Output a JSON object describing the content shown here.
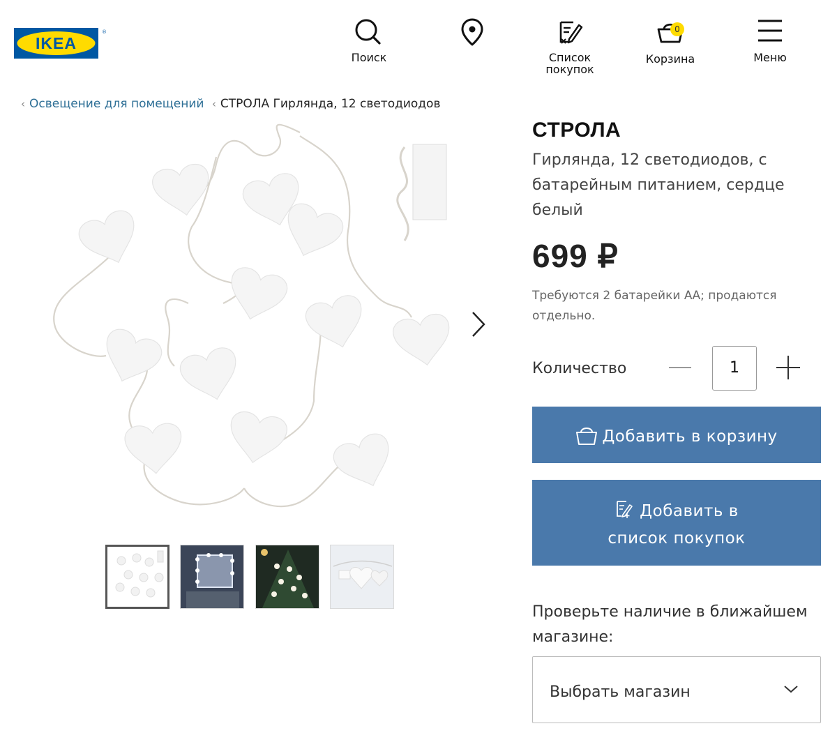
{
  "header": {
    "logo_text": "IKEA",
    "nav": {
      "search": "Поиск",
      "list_line1": "Список",
      "list_line2": "покупок",
      "cart": "Корзина",
      "cart_count": "0",
      "menu": "Меню"
    }
  },
  "breadcrumb": {
    "parent": "Освещение для помещений",
    "current": "СТРОЛА Гирлянда, 12 светодиодов"
  },
  "product": {
    "name": "СТРОЛА",
    "description": "Гирлянда, 12 светодиодов, с батарейным питанием, сердце белый",
    "price": "699 ₽",
    "note": "Требуются 2 батарейки АА; продаются отдельно."
  },
  "quantity": {
    "label": "Количество",
    "value": "1"
  },
  "buttons": {
    "add_to_cart": "Добавить в корзину",
    "add_to_list": "Добавить в список покупок"
  },
  "store": {
    "label": "Проверьте наличие в ближайшем магазине:",
    "select_value": "Выбрать магазин"
  },
  "gallery": {
    "thumbnail_count": 4,
    "active_thumbnail": 1
  },
  "colors": {
    "button_blue": "#4a79ab",
    "link_blue": "#2e6f96",
    "logo_blue": "#0058a3",
    "logo_yellow": "#ffdb00"
  }
}
